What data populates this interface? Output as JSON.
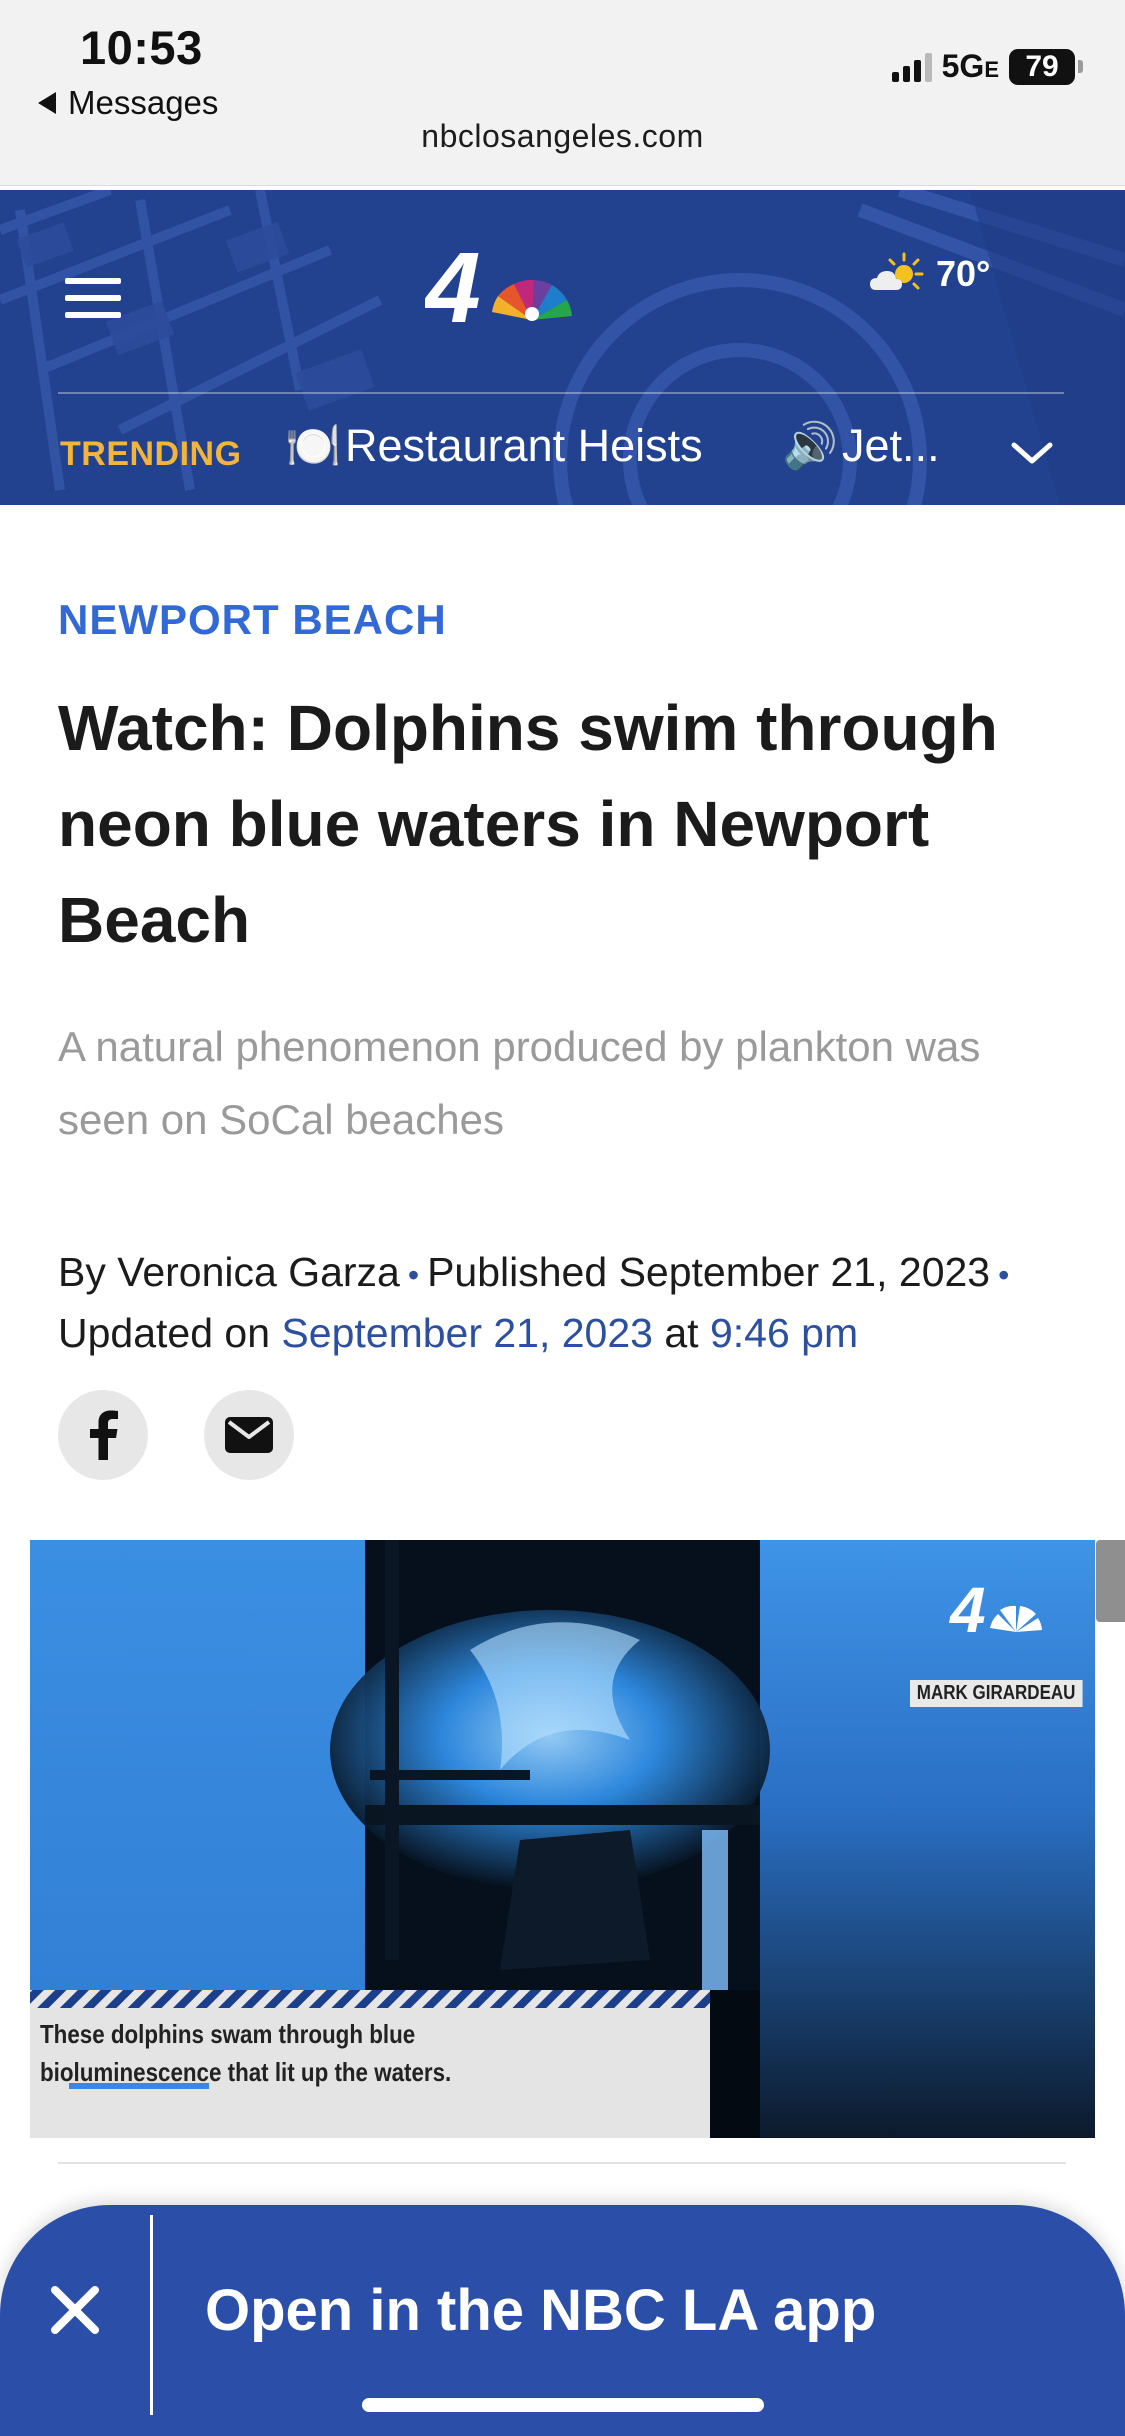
{
  "status_bar": {
    "time": "10:53",
    "back_label": "Messages",
    "network": "5G",
    "network_suffix": "E",
    "battery": "79",
    "url": "nbclosangeles.com"
  },
  "header": {
    "logo_icon": "nbc4-peacock-logo",
    "menu_icon": "hamburger-icon",
    "weather_icon": "partly-sunny-icon",
    "temperature": "70°",
    "trending_label": "TRENDING",
    "trending_items": [
      {
        "emoji": "🍽️",
        "label": "Restaurant Heists"
      },
      {
        "emoji": "🔊",
        "label": "Jet..."
      }
    ],
    "expand_icon": "chevron-down-icon",
    "bg_color": "#22418f",
    "trending_color": "#f2b43a"
  },
  "article": {
    "kicker": "NEWPORT BEACH",
    "headline": "Watch: Dolphins swim through neon blue waters in Newport Beach",
    "deck": "A natural phenomenon produced by plankton was seen on SoCal beaches",
    "byline": {
      "by_prefix": "By",
      "author": "Veronica Garza",
      "published_prefix": "Published",
      "published_date": "September 21, 2023",
      "updated_prefix": "Updated on",
      "updated_date": "September 21, 2023",
      "at": "at",
      "updated_time": "9:46 pm"
    },
    "share_icons": [
      "facebook-icon",
      "email-icon"
    ],
    "accent_color": "#3269d4"
  },
  "video": {
    "caption": "These dolphins swam through blue bioluminescence that lit up the waters.",
    "credit": "MARK GIRARDEAU"
  },
  "app_banner": {
    "label": "Open in the NBC LA app",
    "close_icon": "close-icon",
    "bg_color": "#2b4fa8"
  }
}
